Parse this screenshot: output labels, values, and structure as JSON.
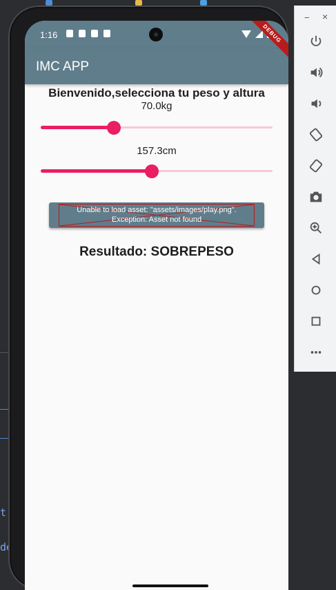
{
  "app": {
    "title": "IMC APP",
    "debug_banner": "DEBUG",
    "heading": "Bienvenido,selecciona tu peso y altura",
    "button_error_line1": "Unable to load asset: \"assets/images/play.png\".",
    "button_error_line2": "Exception: Asset not found",
    "result": "Resultado: SOBREPESO"
  },
  "status_bar": {
    "time": "1:16"
  },
  "weight_slider": {
    "label": "70.0kg",
    "fraction": 0.315
  },
  "height_slider": {
    "label": "157.3cm",
    "fraction": 0.48
  },
  "ide": {
    "left_fragment_1": "t:",
    "left_fragment_2": "de"
  },
  "emulator_toolbar": {
    "minimize": "−",
    "close": "×",
    "buttons": [
      "power-icon",
      "volume-up-icon",
      "volume-down-icon",
      "rotate-left-icon",
      "rotate-right-icon",
      "camera-icon",
      "zoom-icon",
      "back-icon",
      "home-icon",
      "overview-icon",
      "more-icon"
    ]
  },
  "colors": {
    "appbar": "#607d8b",
    "accent": "#e91e63",
    "accent_light": "#f8c8d6"
  }
}
